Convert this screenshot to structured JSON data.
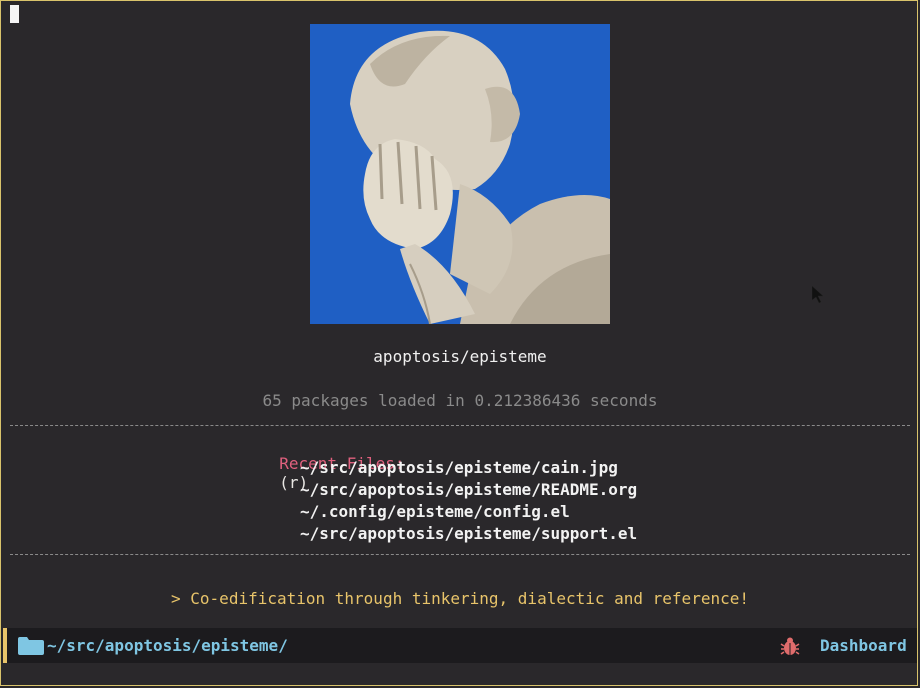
{
  "banner": {
    "caption_alt": "facepalm-statue"
  },
  "dashboard": {
    "title": "apoptosis/episteme",
    "loaded": "65 packages loaded in 0.212386436 seconds",
    "recent": {
      "heading": "Recent Files:",
      "key": "(r)",
      "files": [
        "~/src/apoptosis/episteme/cain.jpg",
        "~/src/apoptosis/episteme/README.org",
        "~/.config/episteme/config.el",
        "~/src/apoptosis/episteme/support.el"
      ]
    },
    "footer": "> Co-edification through tinkering, dialectic and reference!"
  },
  "modeline": {
    "path": "~/src/apoptosis/episteme/",
    "mode": "Dashboard",
    "icons": [
      "folder-icon",
      "bug-icon"
    ]
  },
  "colors": {
    "background": "#2a282b",
    "heading": "#e0607e",
    "footer": "#e8c46a",
    "modeline_text": "#7fc6e3",
    "bug": "#e06c6c"
  }
}
